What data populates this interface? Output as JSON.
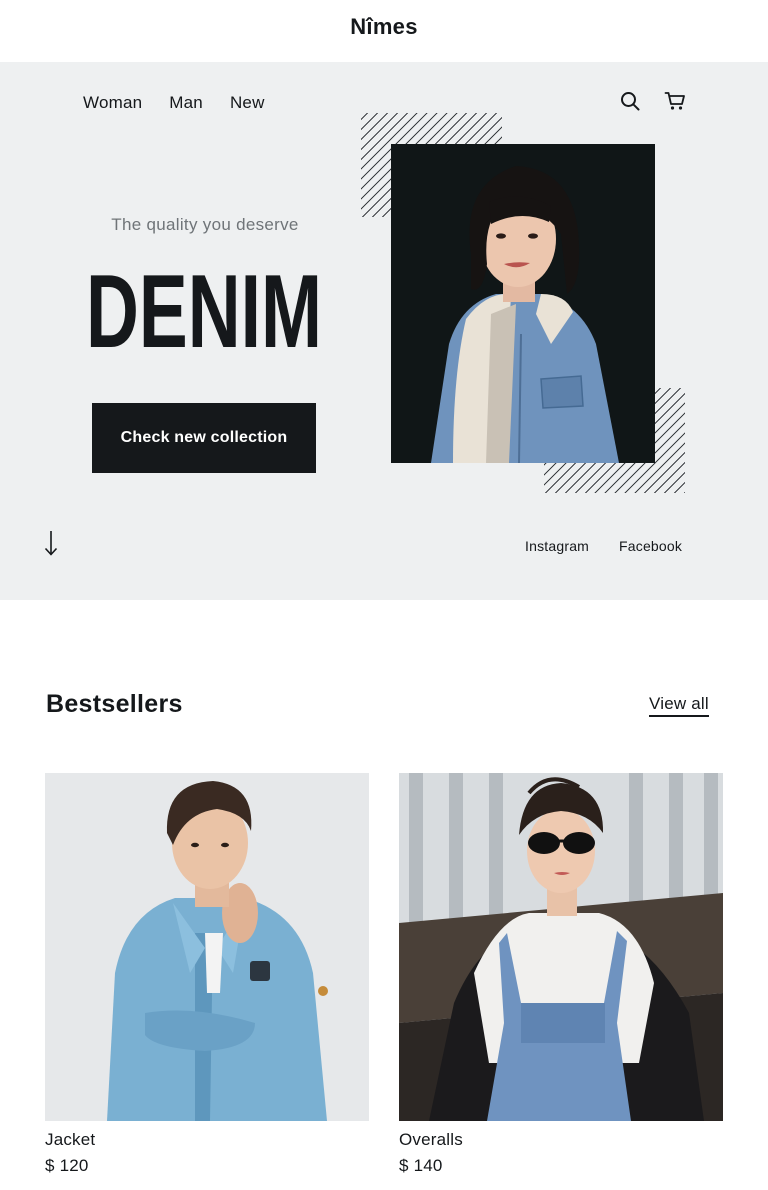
{
  "header": {
    "brand": "Nîmes"
  },
  "nav": {
    "items": [
      "Woman",
      "Man",
      "New"
    ]
  },
  "icons": {
    "search": "search-icon",
    "cart": "cart-icon",
    "scroll": "arrow-down-icon"
  },
  "hero": {
    "tagline": "The quality you deserve",
    "headline": "DENIM",
    "cta_label": "Check new collection",
    "social": [
      "Instagram",
      "Facebook"
    ]
  },
  "bestsellers": {
    "title": "Bestsellers",
    "view_all_label": "View all",
    "products": [
      {
        "name": "Jacket",
        "price": "$ 120"
      },
      {
        "name": "Overalls",
        "price": "$ 140"
      }
    ]
  },
  "colors": {
    "dark": "#15181b",
    "hero_bg": "#eef0f1",
    "muted_text": "#6f7478",
    "denim": "#6f93bd"
  }
}
